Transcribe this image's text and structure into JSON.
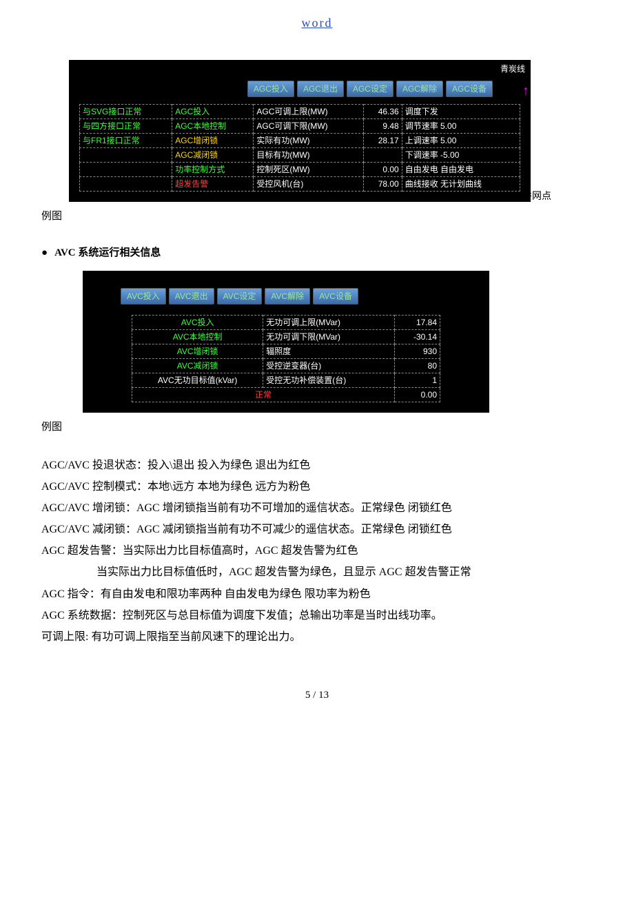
{
  "header_link": "word",
  "agc": {
    "caption": "例图",
    "top_label": "青炭线",
    "grid_point": "并网点",
    "tabs": [
      "AGC投入",
      "AGC退出",
      "AGC设定",
      "AGC解除",
      "AGC设备"
    ],
    "rows": [
      {
        "c0": "与SVG接口正常",
        "c0cls": "green",
        "c1": "AGC投入",
        "c1cls": "green",
        "c2": "AGC可调上限(MW)",
        "c3": "46.36",
        "c4": "调度下发"
      },
      {
        "c0": "与四方接口正常",
        "c0cls": "green",
        "c1": "AGC本地控制",
        "c1cls": "green",
        "c2": "AGC可调下限(MW)",
        "c3": "9.48",
        "c4": "调节速率 5.00"
      },
      {
        "c0": "与FR1接口正常",
        "c0cls": "green",
        "c1": "AGC增闭锁",
        "c1cls": "yellow",
        "c2": "实际有功(MW)",
        "c3": "28.17",
        "c4": "上调速率 5.00"
      },
      {
        "c0": "",
        "c0cls": "",
        "c1": "AGC减闭锁",
        "c1cls": "yellow",
        "c2": "目标有功(MW)",
        "c3": "",
        "c4": "下调速率 -5.00"
      },
      {
        "c0": "",
        "c0cls": "",
        "c1": "功率控制方式",
        "c1cls": "green",
        "c2": "控制死区(MW)",
        "c3": "0.00",
        "c4": "自由发电 自由发电"
      },
      {
        "c0": "",
        "c0cls": "",
        "c1": "超发告警",
        "c1cls": "red",
        "c2": "受控风机(台)",
        "c3": "78.00",
        "c4": "曲线接收 无计划曲线"
      }
    ]
  },
  "avc": {
    "title": "AVC 系统运行相关信息",
    "caption": "例图",
    "tabs": [
      "AVC投入",
      "AVC退出",
      "AVC设定",
      "AVC解除",
      "AVC设备"
    ],
    "rows": [
      {
        "c1": "AVC投入",
        "c1cls": "green",
        "c2": "无功可调上限(MVar)",
        "c3": "17.84"
      },
      {
        "c1": "AVC本地控制",
        "c1cls": "green",
        "c2": "无功可调下限(MVar)",
        "c3": "-30.14"
      },
      {
        "c1": "AVC增闭锁",
        "c1cls": "green",
        "c2": "辐照度",
        "c3": "930"
      },
      {
        "c1": "AVC减闭锁",
        "c1cls": "green",
        "c2": "受控逆变器(台)",
        "c3": "80"
      },
      {
        "c1": "AVC无功目标值(kVar)",
        "c1cls": "white",
        "c2": "受控无功补偿装置(台)",
        "c3": "1"
      },
      {
        "c1": "正常",
        "c1cls": "red",
        "span": true,
        "c3": "0.00"
      }
    ]
  },
  "body": {
    "p1": "AGC/AVC 投退状态：投入\\退出    投入为绿色    退出为红色",
    "p2": "AGC/AVC 控制模式：本地\\远方    本地为绿色    远方为粉色",
    "p3": "AGC/AVC 增闭锁：AGC 增闭锁指当前有功不可增加的遥信状态。正常绿色 闭锁红色",
    "p4": "AGC/AVC 减闭锁：AGC 减闭锁指当前有功不可减少的遥信状态。正常绿色 闭锁红色",
    "p5": "AGC 超发告警：当实际出力比目标值高时，AGC 超发告警为红色",
    "p6": "当实际出力比目标值低时，AGC 超发告警为绿色，且显示 AGC 超发告警正常",
    "p7": "AGC 指令：有自由发电和限功率两种    自由发电为绿色    限功率为粉色",
    "p8": "AGC 系统数据：控制死区与总目标值为调度下发值；总输出功率是当时出线功率。",
    "p9": "可调上限: 有功可调上限指至当前风速下的理论出力。"
  },
  "footer": "5 / 13"
}
